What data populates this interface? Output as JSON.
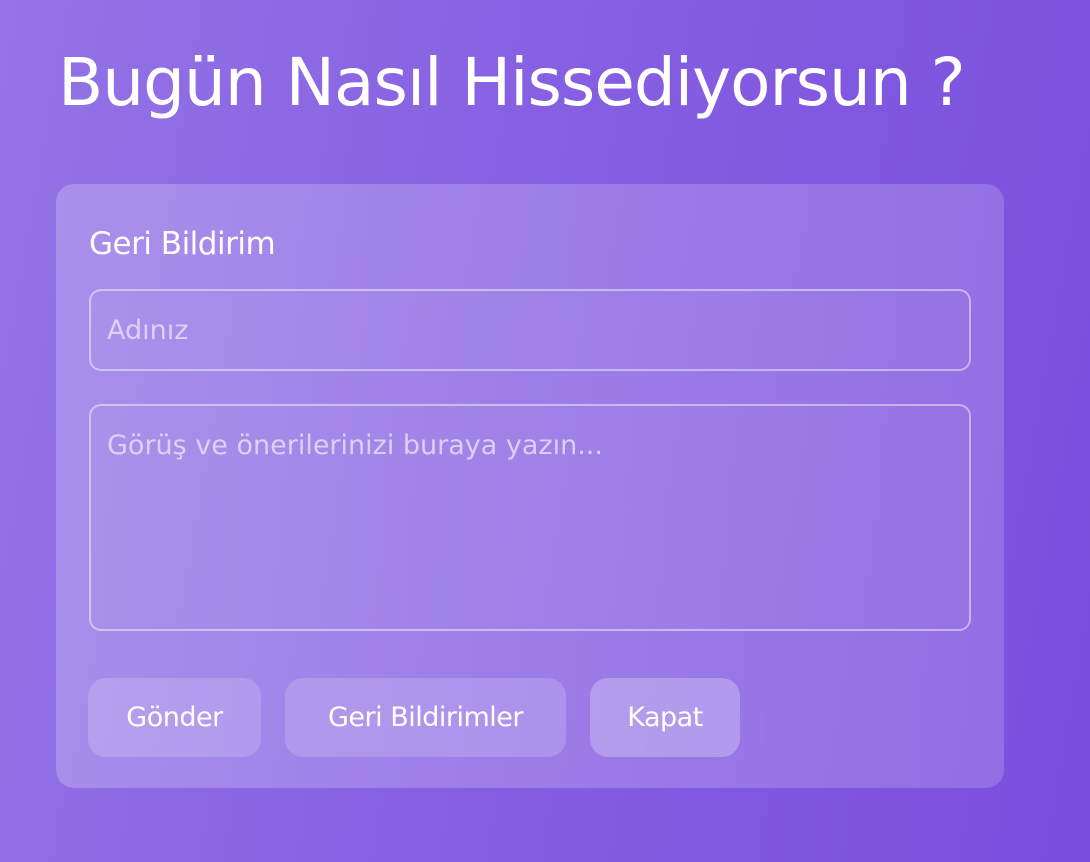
{
  "page": {
    "title": "Bugün Nasıl Hissediyorsun ?"
  },
  "feedback": {
    "heading": "Geri Bildirim",
    "name_input": {
      "value": "",
      "placeholder": "Adınız"
    },
    "message_input": {
      "value": "",
      "placeholder": "Görüş ve önerilerinizi buraya yazın..."
    },
    "buttons": {
      "send_label": "Gönder",
      "feedbacks_label": "Geri Bildirimler",
      "close_label": "Kapat"
    }
  },
  "colors": {
    "background_start": "#9474e6",
    "background_end": "#7a4edd",
    "text": "#ffffff"
  }
}
